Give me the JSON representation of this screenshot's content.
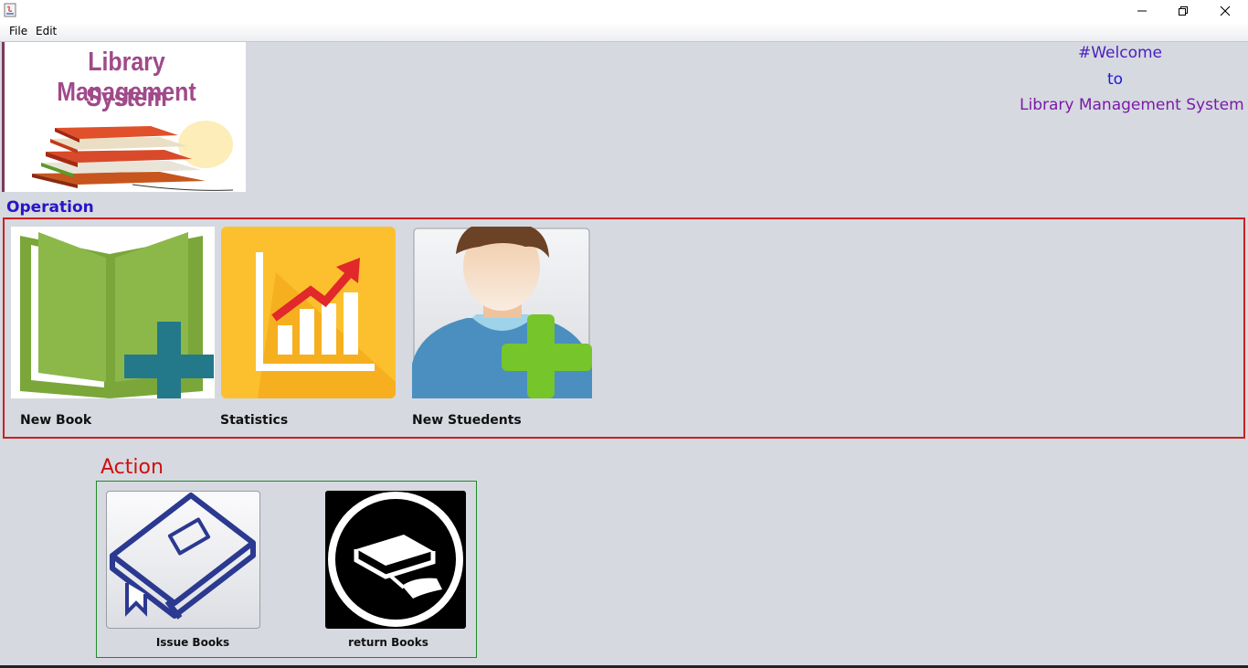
{
  "window": {
    "title": ""
  },
  "menu": {
    "items": [
      "File",
      "Edit"
    ]
  },
  "logo": {
    "line1": "Library Management",
    "line2": "System"
  },
  "welcome": {
    "line1": "#Welcome",
    "line2": "to",
    "line3": "Library Management System"
  },
  "operation": {
    "title": "Operation",
    "tiles": [
      {
        "label": "New Book",
        "icon": "open-book-plus-icon"
      },
      {
        "label": "Statistics",
        "icon": "bar-chart-trend-icon"
      },
      {
        "label": "New Stuedents",
        "icon": "user-add-icon"
      }
    ]
  },
  "action": {
    "title": "Action",
    "buttons": [
      {
        "label": "Issue Books",
        "icon": "book-issue-icon"
      },
      {
        "label": "return Books",
        "icon": "book-return-icon"
      }
    ]
  },
  "colors": {
    "operation_title": "#2a14c8",
    "action_title": "#cc1111",
    "operation_border": "#cc1f1f",
    "action_border": "#1e8a2a",
    "welcome_1": "#4a1ec0",
    "welcome_2": "#1a1ad8",
    "welcome_3": "#7a1aa8"
  }
}
